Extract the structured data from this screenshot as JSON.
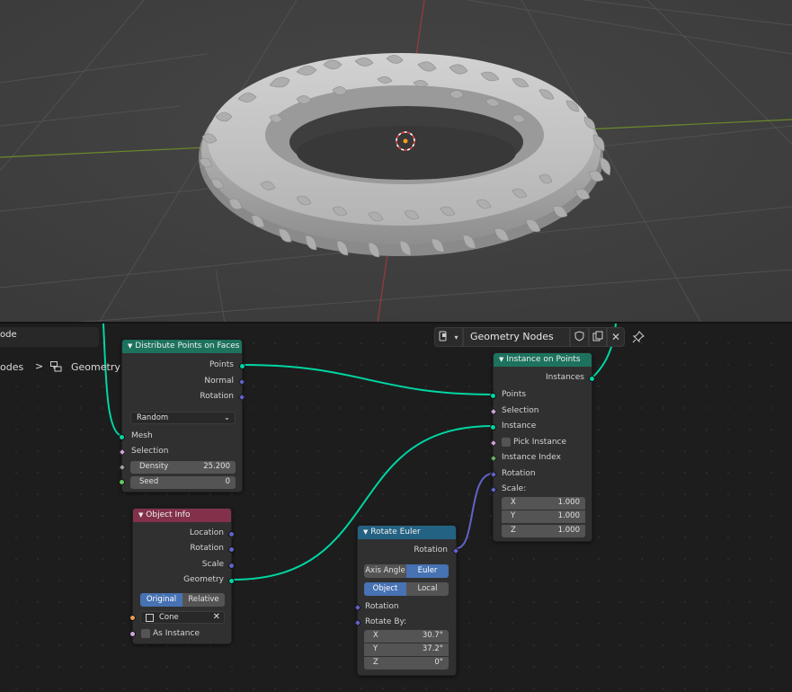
{
  "header": {
    "left_field_text": "ode",
    "breadcrumb_left": "odes",
    "breadcrumb_sep": ">",
    "breadcrumb_tree": "Geometry Nodes",
    "tree_name": "Geometry Nodes"
  },
  "nodes": {
    "distribute": {
      "title": "Distribute Points on Faces",
      "out_points": "Points",
      "out_normal": "Normal",
      "out_rotation": "Rotation",
      "mode": "Random",
      "in_mesh": "Mesh",
      "in_selection": "Selection",
      "density_label": "Density",
      "density_value": "25.200",
      "seed_label": "Seed",
      "seed_value": "0"
    },
    "object_info": {
      "title": "Object Info",
      "out_location": "Location",
      "out_rotation": "Rotation",
      "out_scale": "Scale",
      "out_geometry": "Geometry",
      "opt_original": "Original",
      "opt_relative": "Relative",
      "object_value": "Cone",
      "as_instance": "As Instance"
    },
    "rotate_euler": {
      "title": "Rotate Euler",
      "out_rotation": "Rotation",
      "opt_axis_angle": "Axis Angle",
      "opt_euler": "Euler",
      "opt_object": "Object",
      "opt_local": "Local",
      "in_rotation": "Rotation",
      "in_rotate_by": "Rotate By:",
      "x_label": "X",
      "x_value": "30.7°",
      "y_label": "Y",
      "y_value": "37.2°",
      "z_label": "Z",
      "z_value": "0°"
    },
    "instance_on_points": {
      "title": "Instance on Points",
      "out_instances": "Instances",
      "in_points": "Points",
      "in_selection": "Selection",
      "in_instance": "Instance",
      "pick_instance": "Pick Instance",
      "in_instance_index": "Instance Index",
      "in_rotation": "Rotation",
      "in_scale": "Scale:",
      "x_label": "X",
      "x_value": "1.000",
      "y_label": "Y",
      "y_value": "1.000",
      "z_label": "Z",
      "z_value": "1.000"
    }
  },
  "colors": {
    "geometry_socket": "#00d6a3",
    "vector_socket": "#6363c7",
    "header_geometry": "#1d725e",
    "header_input": "#83314a",
    "header_utility": "#246283",
    "accent_blue": "#4772b3"
  },
  "icons": {
    "editor_type": "node-editor-icon",
    "fake_user": "shield-icon",
    "duplicate": "duplicate-icon",
    "unlink": "close-icon",
    "pin": "pin-icon",
    "tree": "node-tree-icon"
  }
}
